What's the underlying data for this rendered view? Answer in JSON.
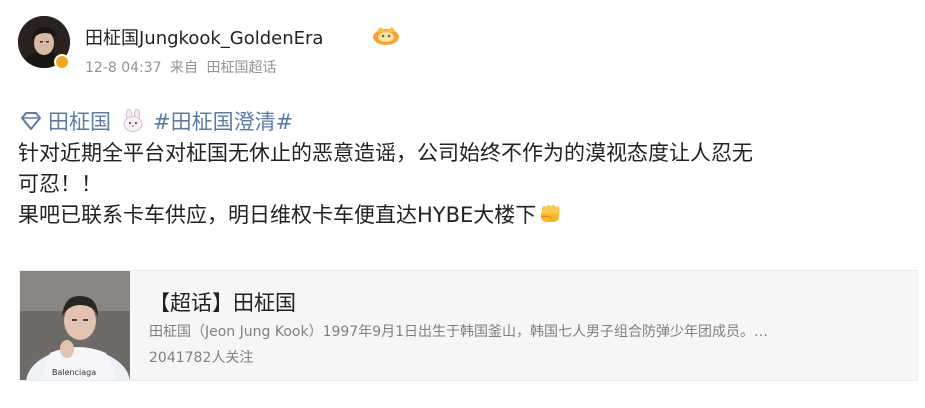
{
  "post": {
    "user_name": "田柾国Jungkook_GoldenEra",
    "time": "12-8 04:37",
    "source_prefix": "来自",
    "source": "田柾国超话",
    "tag_supertopic": "田柾国",
    "tag_hashtag": "#田柾国澄清#",
    "text_line1": "针对近期全平台对柾国无休止的恶意造谣，公司始终不作为的漠视态度让人忍无",
    "text_line2": "可忍！！",
    "text_line3": "果吧已联系卡车供应，明日维权卡车便直达HYBE大楼下",
    "icons": [
      "avatar",
      "verified-badge-icon",
      "vip-crown-icon",
      "diamond-icon",
      "rabbit-emoji-icon",
      "fist-emoji-icon"
    ]
  },
  "card": {
    "title": "【超话】田柾国",
    "description": "田柾国（Jeon Jung Kook）1997年9月1日出生于韩国釜山，韩国七人男子组合防弹少年团成员。…",
    "followers": "2041782人关注"
  },
  "colors": {
    "link": "#5d7ba8",
    "meta": "#939393",
    "card_bg": "#f6f6f6",
    "badge": "#f6a623"
  }
}
